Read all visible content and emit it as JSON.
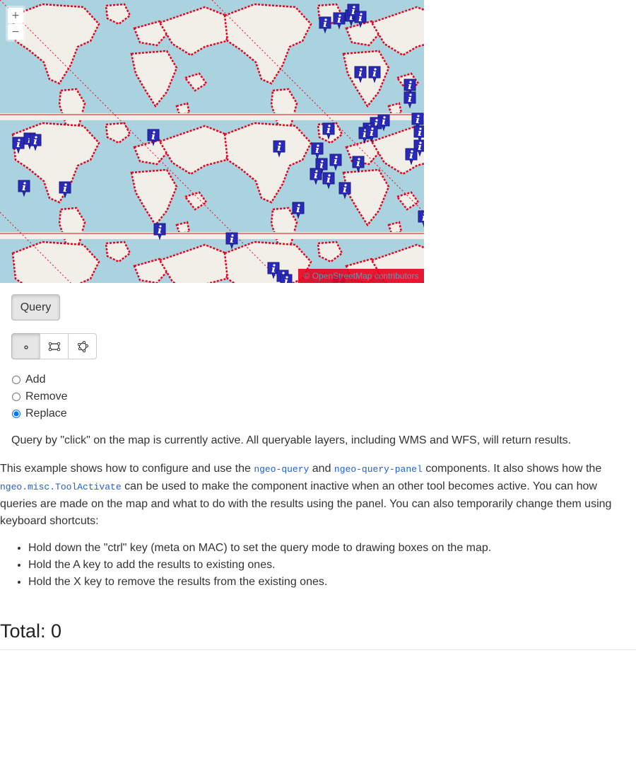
{
  "map": {
    "zoom_in": "+",
    "zoom_out": "−",
    "attribution": "© OpenStreetMap contributors",
    "colors": {
      "water": "#aad3df",
      "land": "#f2efe9",
      "outline": "#e8001c",
      "marker": "#2a2ab8"
    },
    "marker_icon": "info-icon"
  },
  "toolbar": {
    "query_label": "Query",
    "tools": [
      {
        "name": "point-tool",
        "icon": "point-icon",
        "active": true
      },
      {
        "name": "box-tool",
        "icon": "box-icon",
        "active": false
      },
      {
        "name": "polygon-tool",
        "icon": "polygon-icon",
        "active": false
      }
    ]
  },
  "modes": {
    "options": [
      "Add",
      "Remove",
      "Replace"
    ],
    "selected": "Replace"
  },
  "status": "Query by \"click\" on the map is currently active. All queryable layers, including WMS and WFS, will return results.",
  "description": {
    "t1": "This example shows how to configure and use the ",
    "code1": "ngeo-query",
    "t2": " and ",
    "code2": "ngeo-query-panel",
    "t3": " components. It also shows how the ",
    "code3": "ngeo.misc.ToolActivate",
    "t4": " can be used to make the component inactive when an other tool becomes active. You can how queries are made on the map and what to do with the results using the panel. You can also temporarily change them using keyboard shortcuts:"
  },
  "tips": [
    "Hold down the \"ctrl\" key (meta on MAC) to set the query mode to drawing boxes on the map.",
    "Hold the A key to add the results to existing ones.",
    "Hold the X key to remove the results from the existing ones."
  ],
  "total": "Total: 0"
}
